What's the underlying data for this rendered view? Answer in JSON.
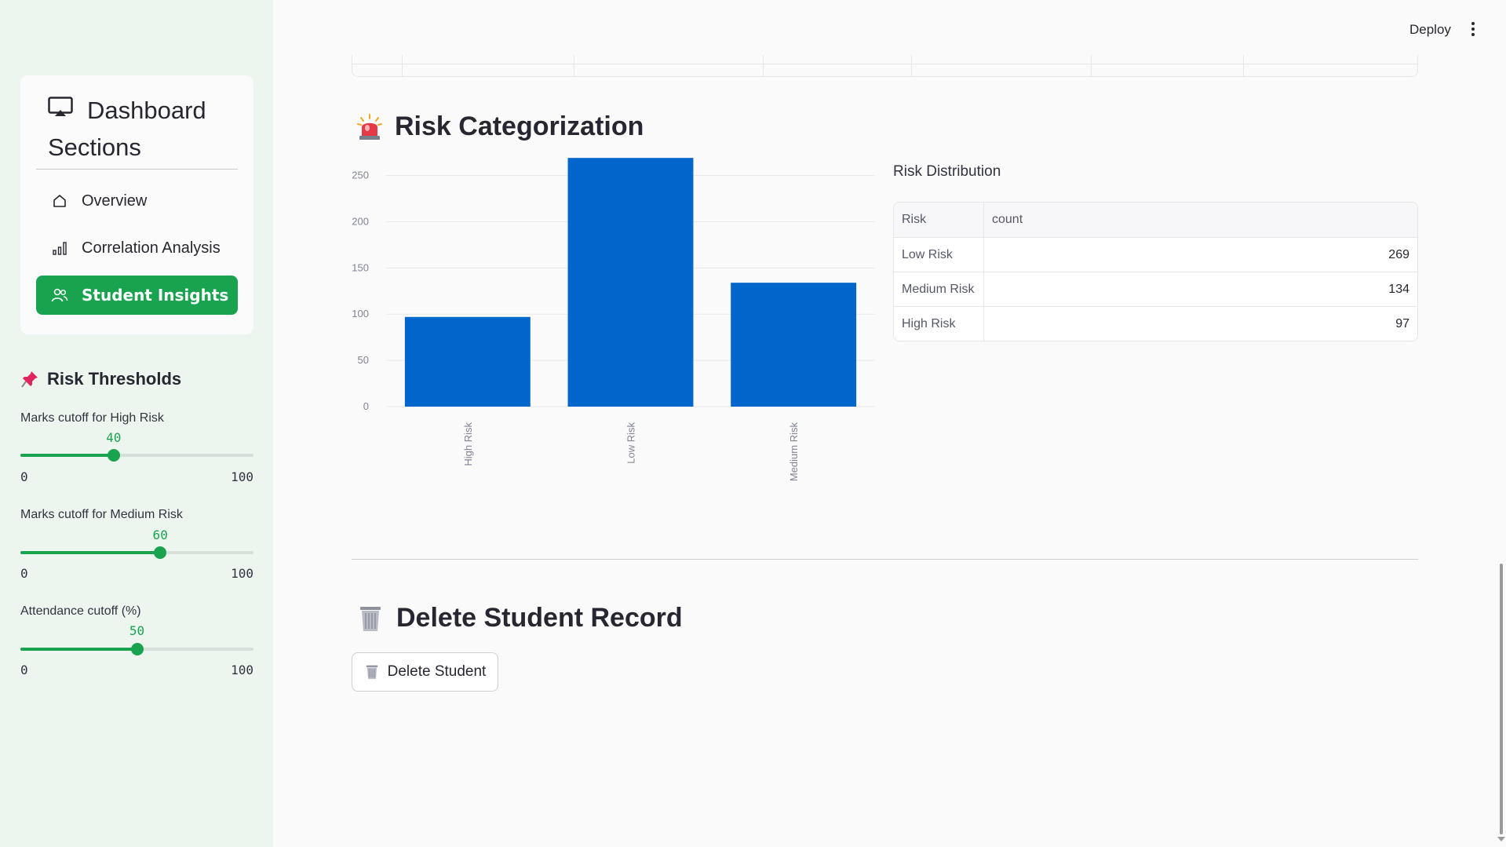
{
  "sidebar": {
    "title": "Dashboard Sections",
    "title_icon": "tv-icon",
    "nav_items": [
      {
        "label": "Overview",
        "icon": "house-icon",
        "active": false
      },
      {
        "label": "Correlation Analysis",
        "icon": "bar-chart-icon",
        "active": false
      },
      {
        "label": "Student Insights",
        "icon": "people-icon",
        "active": true
      }
    ],
    "thresholds_heading": "Risk Thresholds",
    "thresholds_icon": "pushpin-icon",
    "sliders": [
      {
        "label": "Marks cutoff for High Risk",
        "value": "40",
        "min": "0",
        "max": "100",
        "fraction": 0.4
      },
      {
        "label": "Marks cutoff for Medium Risk",
        "value": "60",
        "min": "0",
        "max": "100",
        "fraction": 0.6
      },
      {
        "label": "Attendance cutoff (%)",
        "value": "50",
        "min": "0",
        "max": "100",
        "fraction": 0.5
      }
    ]
  },
  "header": {
    "deploy_label": "Deploy",
    "menu_icon": "kebab-menu-icon"
  },
  "risk_section": {
    "heading": "Risk Categorization",
    "icon": "siren-icon"
  },
  "chart_data": {
    "type": "bar",
    "categories": [
      "High Risk",
      "Low Risk",
      "Medium Risk"
    ],
    "values": [
      97,
      269,
      134
    ],
    "title": "",
    "xlabel": "",
    "ylabel": "",
    "ylim": [
      0,
      270
    ],
    "yticks": [
      0,
      50,
      100,
      150,
      200,
      250
    ],
    "color": "#0066cc",
    "grid": true
  },
  "distribution": {
    "title": "Risk Distribution",
    "columns": [
      "Risk",
      "count"
    ],
    "rows": [
      {
        "risk": "Low Risk",
        "count": "269"
      },
      {
        "risk": "Medium Risk",
        "count": "134"
      },
      {
        "risk": "High Risk",
        "count": "97"
      }
    ]
  },
  "delete_section": {
    "heading": "Delete Student Record",
    "icon": "wastebasket-icon",
    "button_label": "Delete Student"
  },
  "colors": {
    "accent": "#19a34f",
    "bar": "#0066cc",
    "sidebar_bg": "#edf5ef"
  }
}
